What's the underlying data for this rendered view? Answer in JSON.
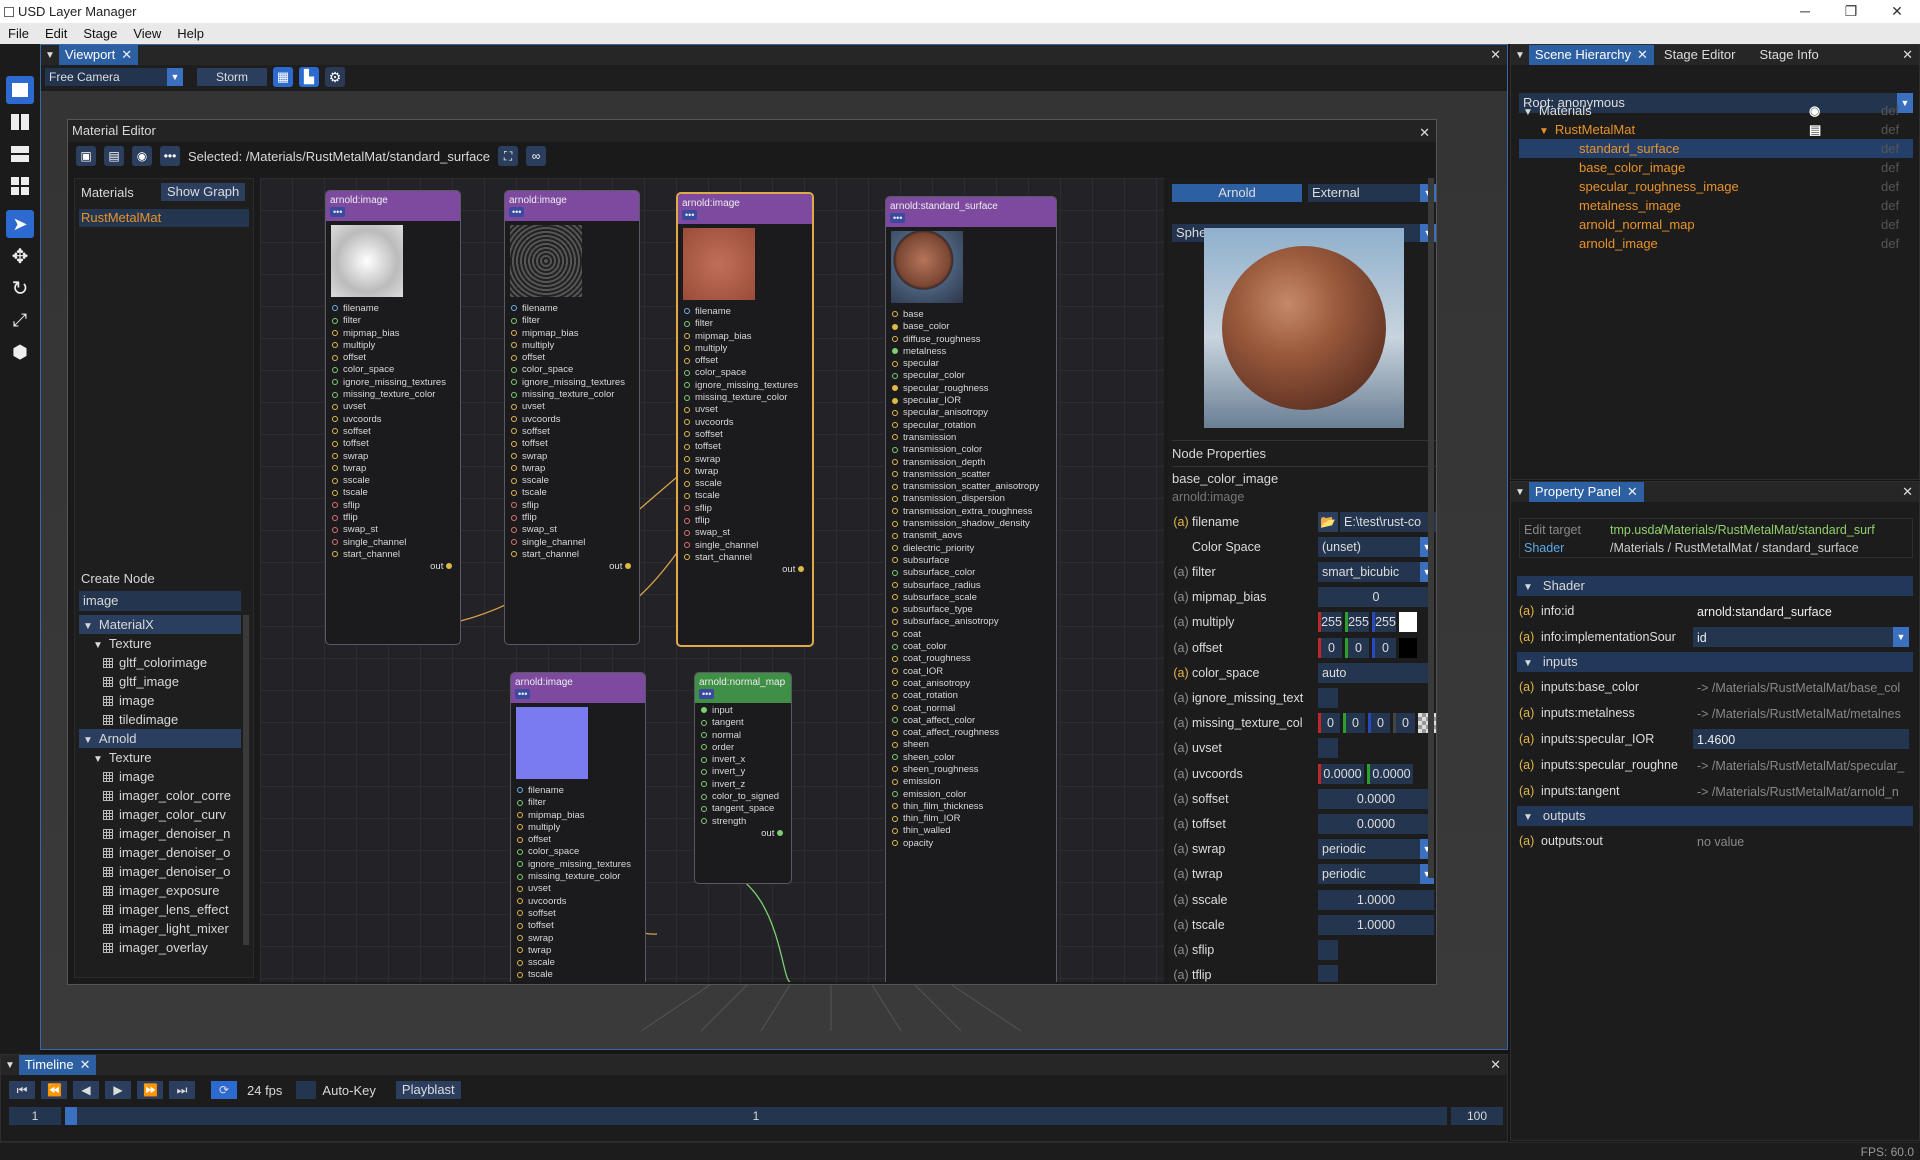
{
  "window": {
    "title": "USD Layer Manager"
  },
  "menu": [
    "File",
    "Edit",
    "Stage",
    "View",
    "Help"
  ],
  "viewport": {
    "tab": "Viewport",
    "camera": "Free Camera",
    "renderer": "Storm"
  },
  "material_editor": {
    "title": "Material Editor",
    "selected": "Selected: /Materials/RustMetalMat/standard_surface",
    "materials_label": "Materials",
    "show_graph": "Show Graph",
    "material_item": "RustMetalMat",
    "create_node_label": "Create Node",
    "search_value": "image",
    "tree": [
      {
        "level": 0,
        "label": "MaterialX",
        "hl": true
      },
      {
        "level": 1,
        "label": "Texture"
      },
      {
        "level": 2,
        "label": "gltf_colorimage"
      },
      {
        "level": 2,
        "label": "gltf_image"
      },
      {
        "level": 2,
        "label": "image"
      },
      {
        "level": 2,
        "label": "tiledimage"
      },
      {
        "level": 0,
        "label": "Arnold",
        "hl": true
      },
      {
        "level": 1,
        "label": "Texture"
      },
      {
        "level": 2,
        "label": "image"
      },
      {
        "level": 2,
        "label": "imager_color_corre"
      },
      {
        "level": 2,
        "label": "imager_color_curv"
      },
      {
        "level": 2,
        "label": "imager_denoiser_n"
      },
      {
        "level": 2,
        "label": "imager_denoiser_o"
      },
      {
        "level": 2,
        "label": "imager_denoiser_o"
      },
      {
        "level": 2,
        "label": "imager_exposure"
      },
      {
        "level": 2,
        "label": "imager_lens_effect"
      },
      {
        "level": 2,
        "label": "imager_light_mixer"
      },
      {
        "level": 2,
        "label": "imager_overlay"
      }
    ],
    "graph": {
      "image_title": "arnold:image",
      "dots": "•••",
      "image_pins": [
        "filename",
        "filter",
        "mipmap_bias",
        "multiply",
        "offset",
        "color_space",
        "ignore_missing_textures",
        "missing_texture_color",
        "uvset",
        "uvcoords",
        "soffset",
        "toffset",
        "swrap",
        "twrap",
        "sscale",
        "tscale",
        "sflip",
        "tflip",
        "swap_st",
        "single_channel",
        "start_channel"
      ],
      "out": "out",
      "surface_title": "arnold:standard_surface",
      "surface_pins": [
        "base",
        "base_color",
        "diffuse_roughness",
        "metalness",
        "specular",
        "specular_color",
        "specular_roughness",
        "specular_IOR",
        "specular_anisotropy",
        "specular_rotation",
        "transmission",
        "transmission_color",
        "transmission_depth",
        "transmission_scatter",
        "transmission_scatter_anisotropy",
        "transmission_dispersion",
        "transmission_extra_roughness",
        "transmission_shadow_density",
        "transmit_aovs",
        "dielectric_priority",
        "subsurface",
        "subsurface_color",
        "subsurface_radius",
        "subsurface_scale",
        "subsurface_type",
        "subsurface_anisotropy",
        "coat",
        "coat_color",
        "coat_roughness",
        "coat_IOR",
        "coat_anisotropy",
        "coat_rotation",
        "coat_normal",
        "coat_affect_color",
        "coat_affect_roughness",
        "sheen",
        "sheen_color",
        "sheen_roughness",
        "emission",
        "emission_color",
        "thin_film_thickness",
        "thin_film_IOR",
        "thin_walled",
        "opacity"
      ],
      "normal_title": "arnold:normal_map",
      "normal_pins": [
        "input",
        "tangent",
        "normal",
        "order",
        "invert_x",
        "invert_y",
        "invert_z",
        "color_to_signed",
        "tangent_space",
        "strength"
      ]
    },
    "preview": {
      "renderer": "Arnold",
      "mode": "External",
      "shape": "Sphere"
    },
    "node_props": {
      "label": "Node Properties",
      "name": "base_color_image",
      "type": "arnold:image",
      "rows": [
        {
          "a": "(a)",
          "ay": true,
          "name": "filename",
          "value": "E:\\test\\rust-co"
        },
        {
          "a": "",
          "name": "Color Space",
          "value": "(unset)"
        },
        {
          "a": "(a)",
          "name": "filter",
          "value": "smart_bicubic"
        },
        {
          "a": "(a)",
          "name": "mipmap_bias",
          "value": "0"
        },
        {
          "a": "(a)",
          "name": "multiply",
          "v1": "255",
          "v2": "255",
          "v3": "255"
        },
        {
          "a": "(a)",
          "name": "offset",
          "v1": "0",
          "v2": "0",
          "v3": "0"
        },
        {
          "a": "(a)",
          "ay": true,
          "name": "color_space",
          "value": "auto"
        },
        {
          "a": "(a)",
          "name": "ignore_missing_text",
          "value": ""
        },
        {
          "a": "(a)",
          "name": "missing_texture_col",
          "v1": "0",
          "v2": "0",
          "v3": "0",
          "v4": "0"
        },
        {
          "a": "(a)",
          "name": "uvset",
          "value": ""
        },
        {
          "a": "(a)",
          "name": "uvcoords",
          "v1": "0.0000",
          "v2": "0.0000"
        },
        {
          "a": "(a)",
          "name": "soffset",
          "value": "0.0000"
        },
        {
          "a": "(a)",
          "name": "toffset",
          "value": "0.0000"
        },
        {
          "a": "(a)",
          "name": "swrap",
          "value": "periodic"
        },
        {
          "a": "(a)",
          "name": "twrap",
          "value": "periodic"
        },
        {
          "a": "(a)",
          "name": "sscale",
          "value": "1.0000"
        },
        {
          "a": "(a)",
          "name": "tscale",
          "value": "1.0000"
        },
        {
          "a": "(a)",
          "name": "sflip",
          "value": ""
        },
        {
          "a": "(a)",
          "name": "tflip",
          "value": ""
        }
      ]
    }
  },
  "timeline": {
    "tab": "Timeline",
    "fps": "24 fps",
    "autokey": "Auto-Key",
    "playblast": "Playblast",
    "start": "1",
    "current": "1",
    "end": "100"
  },
  "status": {
    "fps": "FPS: 60.0"
  },
  "hierarchy": {
    "tabs": [
      "Scene Hierarchy",
      "Stage Editor",
      "Stage Info"
    ],
    "root": "Root: anonymous",
    "items": [
      {
        "label": "Materials",
        "def": "def",
        "level": 0,
        "color": "#dddddd"
      },
      {
        "label": "RustMetalMat",
        "def": "def",
        "level": 1,
        "color": "#e8922a"
      },
      {
        "label": "standard_surface",
        "def": "def",
        "level": 2,
        "color": "#e8922a",
        "sel": true
      },
      {
        "label": "base_color_image",
        "def": "def",
        "level": 2,
        "color": "#e8922a"
      },
      {
        "label": "specular_roughness_image",
        "def": "def",
        "level": 2,
        "color": "#e8922a"
      },
      {
        "label": "metalness_image",
        "def": "def",
        "level": 2,
        "color": "#e8922a"
      },
      {
        "label": "arnold_normal_map",
        "def": "def",
        "level": 2,
        "color": "#e8922a"
      },
      {
        "label": "arnold_image",
        "def": "def",
        "level": 2,
        "color": "#e8922a"
      }
    ]
  },
  "property_panel": {
    "tab": "Property Panel",
    "edit_target_label": "Edit target",
    "edit_target_file": "tmp.usda",
    "edit_target_path": "/Materials/RustMetalMat/standard_surf",
    "shader_label": "Shader",
    "shader_path": "/Materials / RustMetalMat / standard_surface",
    "sections": {
      "shader": "Shader",
      "inputs": "inputs",
      "outputs": "outputs"
    },
    "shader_rows": [
      {
        "name": "info:id",
        "value": "arnold:standard_surface"
      },
      {
        "name": "info:implementationSour",
        "value": "id"
      }
    ],
    "input_rows": [
      {
        "name": "inputs:base_color",
        "value": "-> /Materials/RustMetalMat/base_col"
      },
      {
        "name": "inputs:metalness",
        "value": "-> /Materials/RustMetalMat/metalnes"
      },
      {
        "name": "inputs:specular_IOR",
        "value": "1.4600"
      },
      {
        "name": "inputs:specular_roughne",
        "value": "-> /Materials/RustMetalMat/specular_"
      },
      {
        "name": "inputs:tangent",
        "value": "-> /Materials/RustMetalMat/arnold_n"
      }
    ],
    "output_rows": [
      {
        "name": "outputs:out",
        "value": "no value"
      }
    ]
  }
}
